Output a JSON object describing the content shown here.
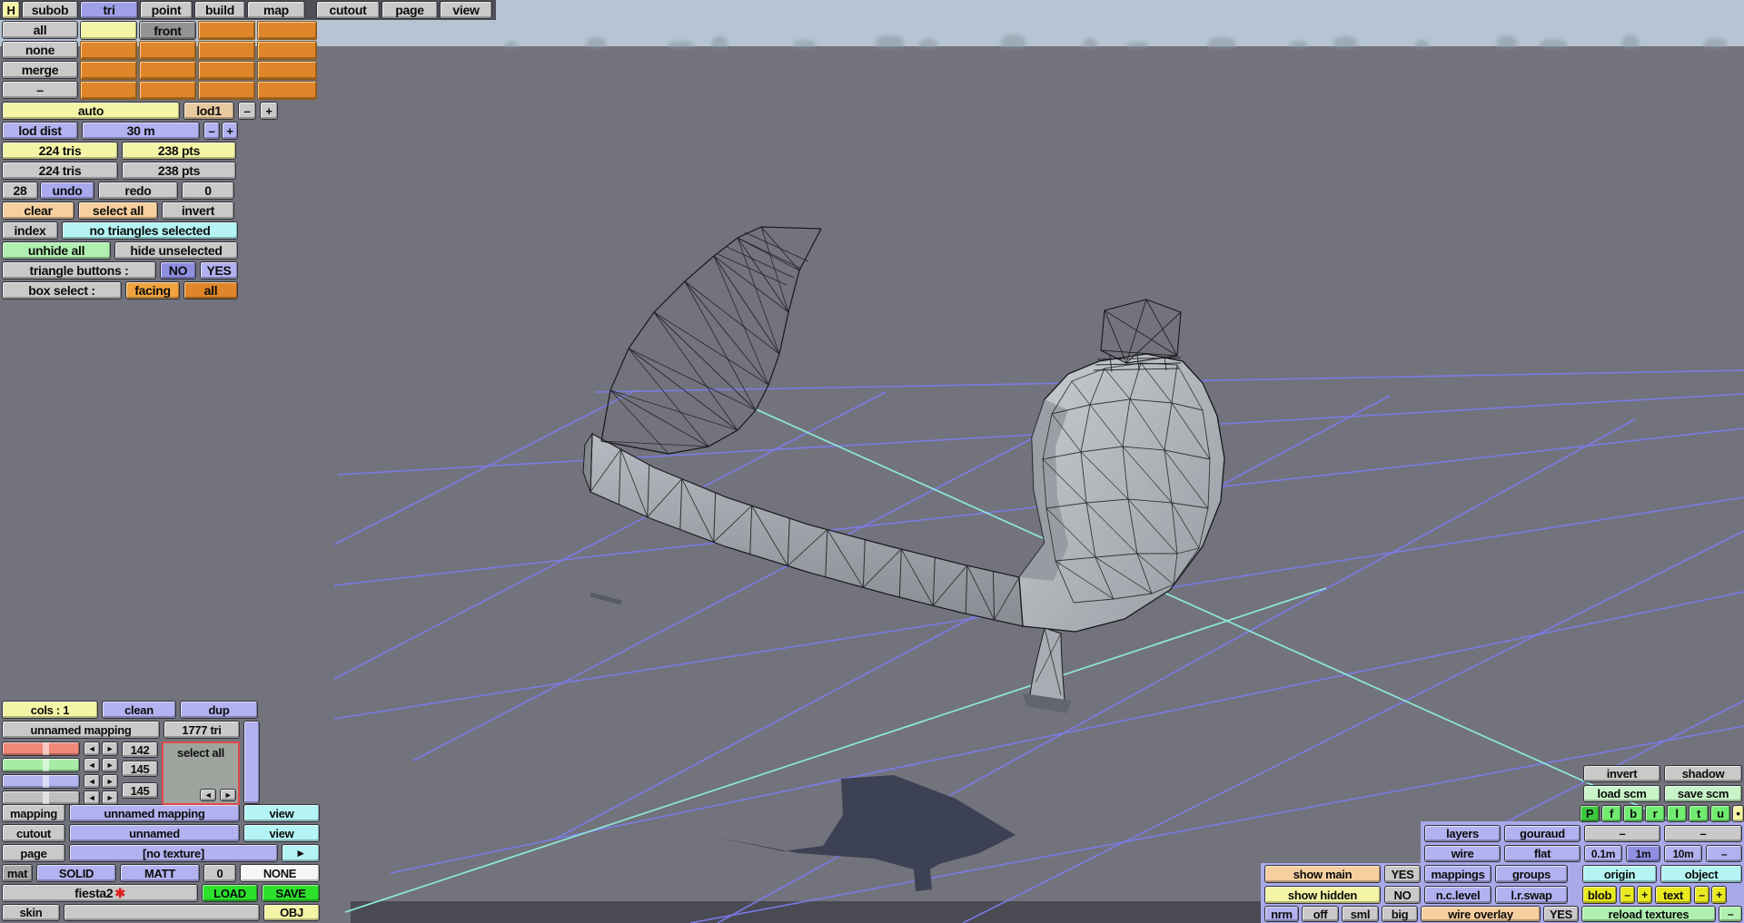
{
  "menu": {
    "labels": [
      "H",
      "subob",
      "tri",
      "point",
      "build",
      "map",
      "cutout",
      "page",
      "view"
    ]
  },
  "grid": {
    "rows": [
      "all",
      "none",
      "merge",
      "–"
    ],
    "front": "front"
  },
  "lod": {
    "auto": "auto",
    "lod1": "lod1",
    "minus": "–",
    "plus": "+",
    "dist_label": "lod dist",
    "dist_value": "30 m"
  },
  "stats": {
    "tris": "224 tris",
    "pts": "238 pts",
    "tris2": "224 tris",
    "pts2": "238 pts"
  },
  "history": {
    "undo_count": "28",
    "undo": "undo",
    "redo": "redo",
    "redo_count": "0"
  },
  "sel": {
    "clear": "clear",
    "select_all": "select all",
    "invert": "invert",
    "index": "index",
    "status": "no triangles selected",
    "unhide": "unhide all",
    "hide_unsel": "hide unselected",
    "tri_label": "triangle buttons :",
    "no": "NO",
    "yes": "YES",
    "box_label": "box select :",
    "facing": "facing",
    "all": "all"
  },
  "map": {
    "cols": "cols : 1",
    "clean": "clean",
    "dup": "dup",
    "name": "unnamed mapping",
    "tri": "1777 tri",
    "sel_all": "select all",
    "v1": "142",
    "v2": "145",
    "v3": "145",
    "left": "◄",
    "right": "►",
    "mapping": "mapping",
    "mapping_val": "unnamed mapping",
    "view": "view",
    "cutout": "cutout",
    "cutout_val": "unnamed",
    "view2": "view",
    "page": "page",
    "page_val": "[no texture]",
    "page_btn": "►",
    "mat": "mat",
    "solid": "SOLID",
    "matt": "MATT",
    "zero": "0",
    "none": "NONE",
    "file": "fiesta2",
    "star": "✱",
    "load": "LOAD",
    "save": "SAVE",
    "skin": "skin",
    "obj": "OBJ"
  },
  "vp": {
    "invert": "invert",
    "shadow": "shadow",
    "load_scm": "load scm",
    "save_scm": "save scm",
    "views": [
      "P",
      "f",
      "b",
      "r",
      "l",
      "t",
      "u"
    ],
    "dot": "•",
    "layers": "layers",
    "gouraud": "gouraud",
    "d1": "–",
    "d2": "–",
    "wire": "wire",
    "flat": "flat",
    "s01": "0.1m",
    "s1": "1m",
    "s10": "10m",
    "sminus": "–",
    "show_main": "show main",
    "yes": "YES",
    "mappings": "mappings",
    "groups": "groups",
    "origin": "origin",
    "object": "object",
    "show_hidden": "show hidden",
    "no": "NO",
    "nc": "n.c.level",
    "lr": "l.r.swap",
    "blob": "blob",
    "bm": "–",
    "bp": "+",
    "text": "text",
    "tm": "–",
    "tp": "+",
    "nrm": "nrm",
    "off": "off",
    "sml": "sml",
    "big": "big",
    "overlay": "wire overlay",
    "oyes": "YES",
    "reload": "reload textures",
    "rminus": "–"
  },
  "colors": {
    "button_gray": "#c9c9c9",
    "lavender": "#b2b2f0",
    "lavender_sel": "#8f8fe2",
    "pale_yellow": "#f4f4a6",
    "tan": "#e8c9a0",
    "peach": "#f6cf9e",
    "orange": "#e0862a",
    "orange_light": "#f0a440",
    "cyan": "#b4f4f4",
    "green_light": "#b0f0b0",
    "green_pale": "#c8f4c8",
    "green_bright": "#2ce02c",
    "green_mid": "#6fec6f",
    "green_dark": "#3cc83c",
    "yellow_bright": "#e9e920",
    "white_cell": "#f6f6f6",
    "gray_mid": "#949494",
    "gray_dark": "#a9a9a9",
    "slider_red": "#f08878",
    "slider_green": "#a6eca6",
    "slider_lav": "#b4b4f0",
    "slider_gray": "#bfbfbf",
    "sky": "#b6c4d3",
    "ground": "#73737d",
    "grid_indigo": "#7b7cec",
    "grid_cyan": "#8ef0e0",
    "shadow_navy": "#3d4154",
    "bar_dark": "#4a4a52"
  }
}
